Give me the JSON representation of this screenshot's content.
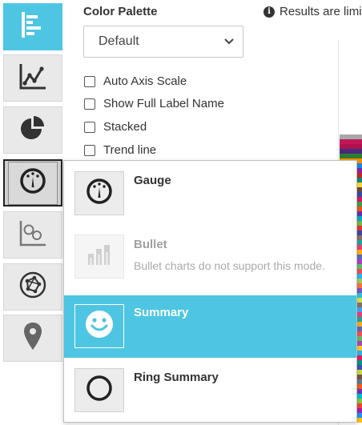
{
  "colors": {
    "accent": "#4ec5e2",
    "rail_bg": "#e9e9e9",
    "icon_dark": "#333333",
    "disabled_text": "#a0a0a0"
  },
  "rail": [
    {
      "icon": "horizontal-bar-chart-icon",
      "state": "active"
    },
    {
      "icon": "line-chart-icon",
      "state": "normal"
    },
    {
      "icon": "pie-chart-icon",
      "state": "normal"
    },
    {
      "icon": "gauge-icon",
      "state": "selected"
    },
    {
      "icon": "scatter-bubble-icon",
      "state": "normal"
    },
    {
      "icon": "network-icon",
      "state": "normal"
    },
    {
      "icon": "map-pin-icon",
      "state": "normal"
    }
  ],
  "options": {
    "palette_label": "Color Palette",
    "palette_value": "Default",
    "notice": "Results are limit",
    "checkboxes": [
      {
        "label": "Auto Axis Scale",
        "checked": false
      },
      {
        "label": "Show Full Label Name",
        "checked": false
      },
      {
        "label": "Stacked",
        "checked": false
      },
      {
        "label": "Trend line",
        "checked": false
      }
    ]
  },
  "menu": {
    "items": [
      {
        "title": "Gauge",
        "description": "",
        "icon": "gauge-icon",
        "state": "normal"
      },
      {
        "title": "Bullet",
        "description": "Bullet charts do not support this mode.",
        "icon": "bullet-chart-icon",
        "state": "disabled"
      },
      {
        "title": "Summary",
        "description": "",
        "icon": "smiley-icon",
        "state": "highlighted"
      },
      {
        "title": "Ring Summary",
        "description": "",
        "icon": "ring-icon",
        "state": "normal"
      }
    ]
  },
  "background_stripes": [
    "#a8a8a8",
    "#c2185b",
    "#b0124f",
    "#4a2a7a",
    "#2e7d32",
    "#ff8f00",
    "#1e88e5",
    "#8e24aa",
    "#c62828",
    "#00897b",
    "#fdd835",
    "#6d4c41",
    "#3949ab",
    "#d81b60",
    "#43a047",
    "#f4511e",
    "#5e35b1",
    "#00acc1",
    "#7cb342",
    "#e53935",
    "#3949ab",
    "#8d6e63",
    "#26a69a",
    "#ec407a",
    "#ffb300",
    "#5c6bc0",
    "#ab47bc",
    "#66bb6a",
    "#ef5350",
    "#29b6f6",
    "#9ccc65",
    "#ff7043",
    "#7e57c2",
    "#26c6da",
    "#d4e157",
    "#8d6e63",
    "#42a5f5",
    "#ec407a",
    "#26a69a",
    "#ffa726",
    "#5c6bc0",
    "#ef5350",
    "#66bb6a",
    "#ab47bc",
    "#ffca28",
    "#29b6f6",
    "#e91e63",
    "#009688",
    "#3f51b5",
    "#cddc39",
    "#795548",
    "#607d8b",
    "#ff5722",
    "#673ab7",
    "#00bcd4",
    "#8bc34a",
    "#f44336",
    "#9c27b0",
    "#2196f3",
    "#ffc107"
  ]
}
